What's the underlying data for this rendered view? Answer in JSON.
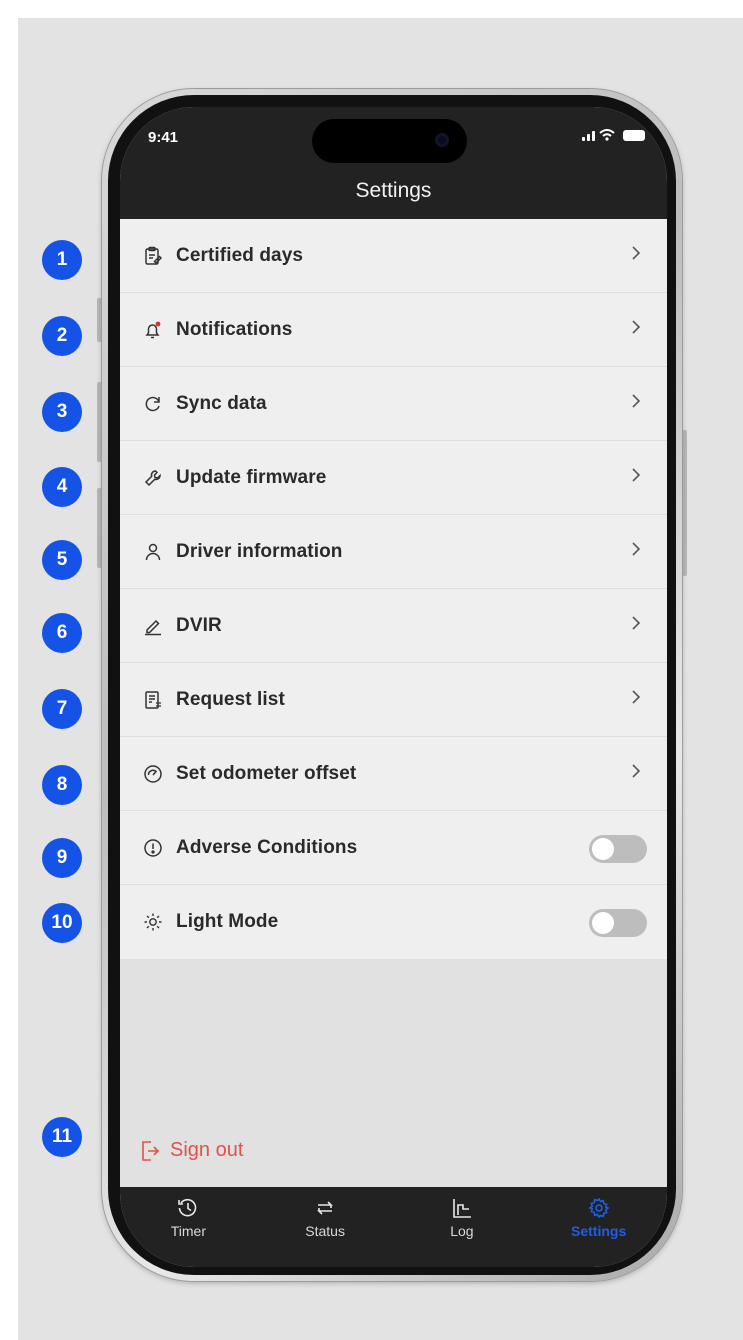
{
  "status_bar": {
    "time": "9:41"
  },
  "header": {
    "title": "Settings"
  },
  "settings": {
    "items": [
      {
        "label": "Certified days",
        "icon": "clipboard-edit-icon",
        "control": "chevron"
      },
      {
        "label": "Notifications",
        "icon": "bell-alert-icon",
        "control": "chevron"
      },
      {
        "label": "Sync data",
        "icon": "sync-icon",
        "control": "chevron"
      },
      {
        "label": "Update firmware",
        "icon": "wrench-icon",
        "control": "chevron"
      },
      {
        "label": "Driver information",
        "icon": "user-icon",
        "control": "chevron"
      },
      {
        "label": "DVIR",
        "icon": "pencil-icon",
        "control": "chevron"
      },
      {
        "label": "Request list",
        "icon": "list-document-icon",
        "control": "chevron"
      },
      {
        "label": "Set odometer offset",
        "icon": "gauge-icon",
        "control": "chevron"
      },
      {
        "label": "Adverse Conditions",
        "icon": "alert-circle-icon",
        "control": "toggle",
        "on": false
      },
      {
        "label": "Light Mode",
        "icon": "sun-icon",
        "control": "toggle",
        "on": false
      }
    ]
  },
  "sign_out": {
    "label": "Sign out",
    "color": "#e0524a"
  },
  "tabbar": {
    "tabs": [
      {
        "label": "Timer",
        "icon": "history-icon",
        "active": false
      },
      {
        "label": "Status",
        "icon": "swap-icon",
        "active": false
      },
      {
        "label": "Log",
        "icon": "graph-icon",
        "active": false
      },
      {
        "label": "Settings",
        "icon": "gear-icon",
        "active": true
      }
    ]
  },
  "annotations": [
    "1",
    "2",
    "3",
    "4",
    "5",
    "6",
    "7",
    "8",
    "9",
    "10",
    "11"
  ],
  "colors": {
    "accent": "#1e5eea",
    "badge": "#1453e6",
    "header_bg": "#222222",
    "list_bg": "#efefef"
  }
}
